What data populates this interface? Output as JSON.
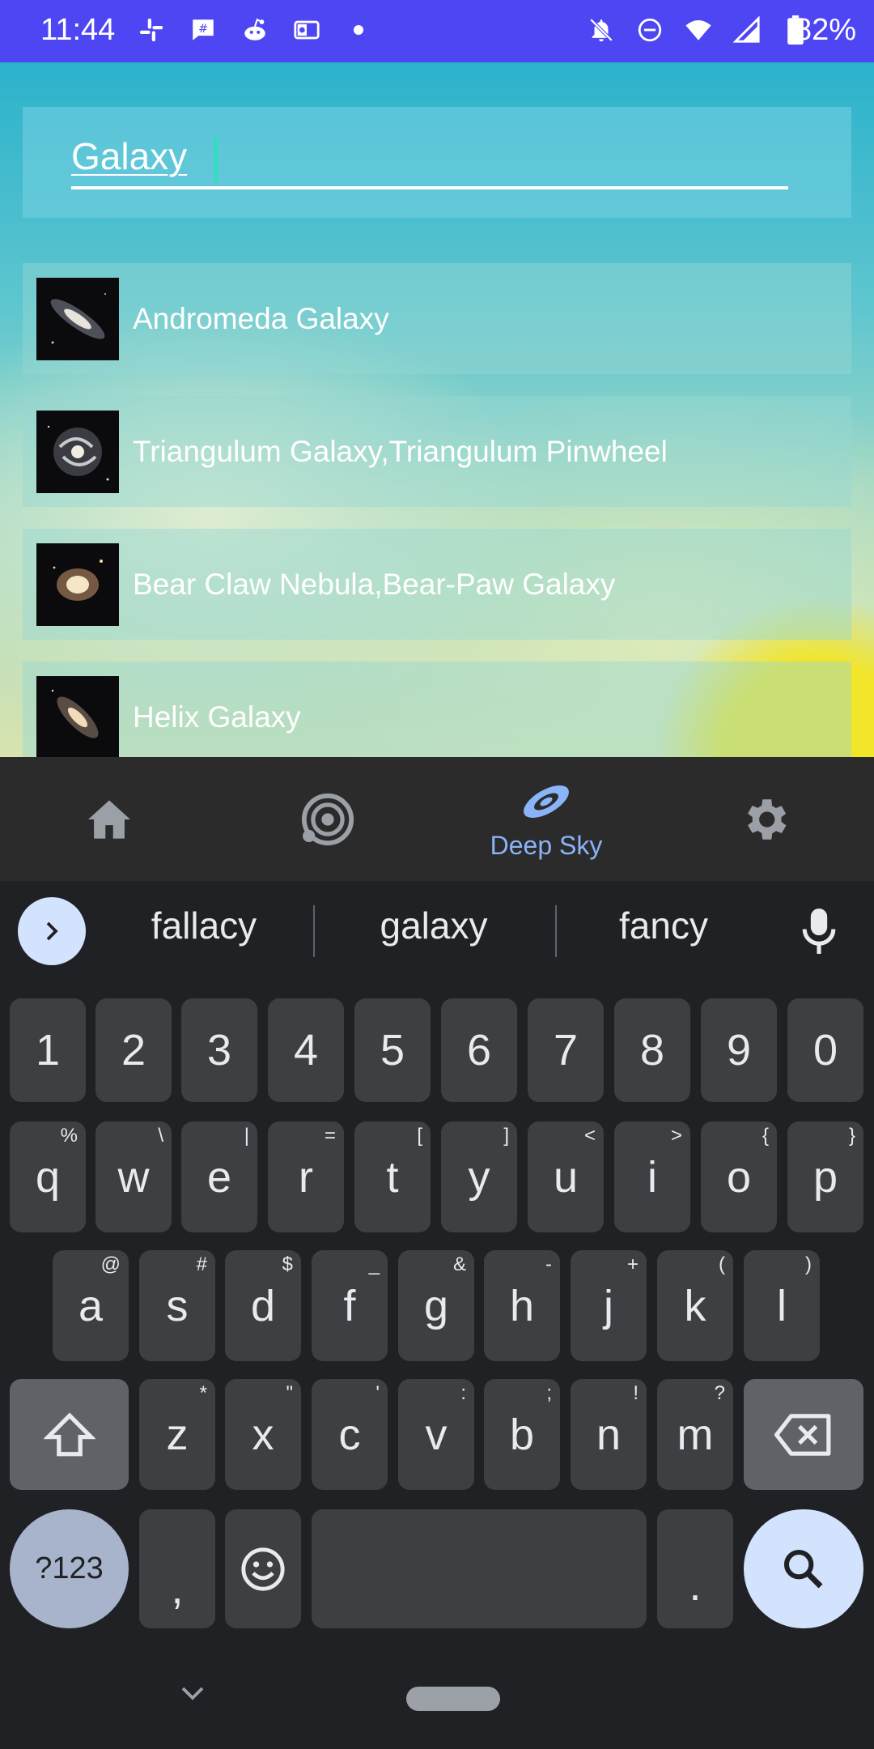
{
  "status_bar": {
    "time": "11:44",
    "battery_percent": "82%",
    "left_icons": [
      "slack-icon",
      "chat-icon",
      "reddit-icon",
      "outlook-icon",
      "dot-icon"
    ],
    "right_icons": [
      "notifications-off-icon",
      "do-not-disturb-icon",
      "wifi-icon",
      "signal-icon",
      "battery-icon"
    ]
  },
  "search": {
    "value": "Galaxy"
  },
  "results": [
    {
      "label": "Andromeda Galaxy"
    },
    {
      "label": "Triangulum Galaxy,Triangulum Pinwheel"
    },
    {
      "label": "Bear Claw Nebula,Bear-Paw Galaxy"
    },
    {
      "label": "Helix Galaxy"
    }
  ],
  "bottom_nav": {
    "items": [
      {
        "icon": "home-icon",
        "label": ""
      },
      {
        "icon": "orbit-icon",
        "label": ""
      },
      {
        "icon": "galaxy-icon",
        "label": "Deep Sky",
        "active": true
      },
      {
        "icon": "gear-icon",
        "label": ""
      }
    ]
  },
  "keyboard": {
    "suggestions": [
      "fallacy",
      "galaxy",
      "fancy"
    ],
    "number_row": [
      "1",
      "2",
      "3",
      "4",
      "5",
      "6",
      "7",
      "8",
      "9",
      "0"
    ],
    "row1": {
      "keys": [
        "q",
        "w",
        "e",
        "r",
        "t",
        "y",
        "u",
        "i",
        "o",
        "p"
      ],
      "sup": [
        "%",
        "\\",
        "|",
        "=",
        "[",
        "]",
        "<",
        ">",
        "{",
        "}"
      ]
    },
    "row2": {
      "keys": [
        "a",
        "s",
        "d",
        "f",
        "g",
        "h",
        "j",
        "k",
        "l"
      ],
      "sup": [
        "@",
        "#",
        "$",
        "_",
        "&",
        "-",
        "+",
        "(",
        ")"
      ]
    },
    "row3": {
      "keys": [
        "z",
        "x",
        "c",
        "v",
        "b",
        "n",
        "m"
      ],
      "sup": [
        "*",
        "\"",
        "'",
        ":",
        ";",
        "!",
        "?"
      ]
    },
    "symbols_key": "?123",
    "comma_key": ",",
    "period_key": "."
  },
  "colors": {
    "status_bar": "#4e46f2",
    "accent": "#8ab4f8",
    "caret": "#1de9b6"
  }
}
